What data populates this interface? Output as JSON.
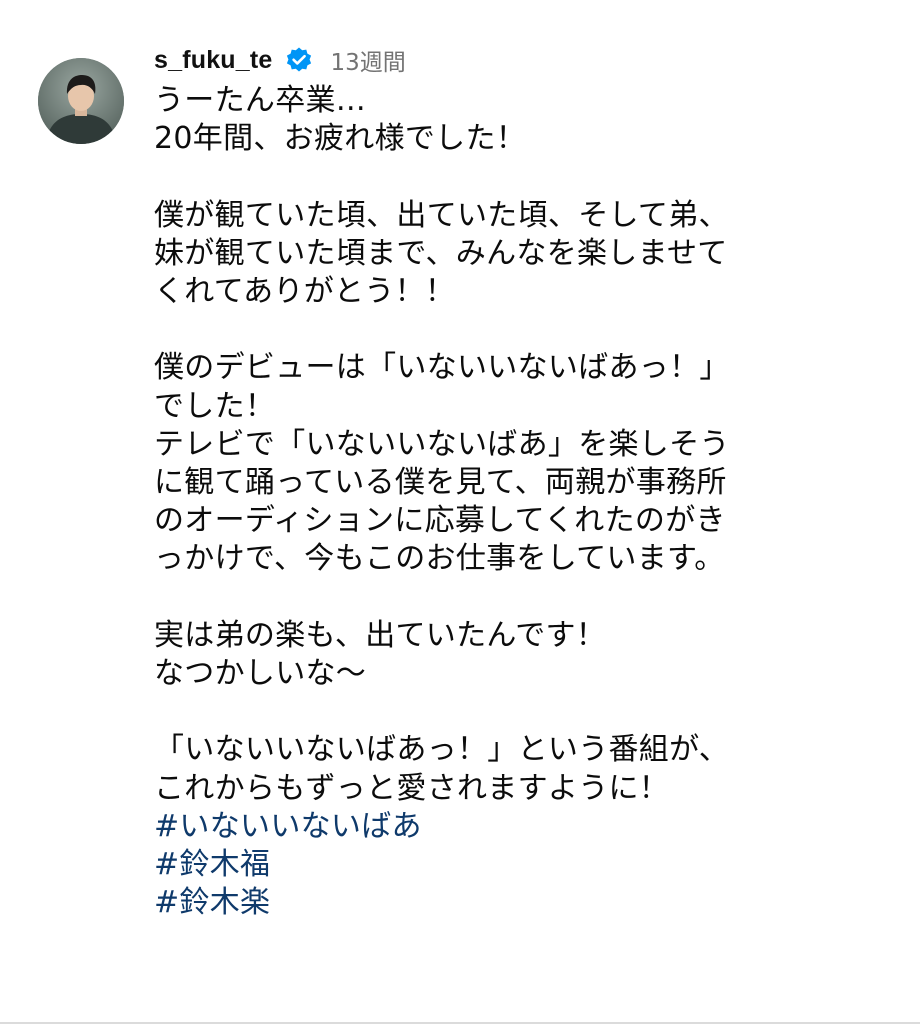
{
  "comment": {
    "username": "s_fuku_te",
    "verified_icon": "verified-badge-icon",
    "timestamp": "13週間",
    "body": "うーたん卒業…\n20年間、お疲れ様でした！\n\n僕が観ていた頃、出ていた頃、そして弟、\n妹が観ていた頃まで、みんなを楽しませて\nくれてありがとう！！\n\n僕のデビューは「いないいないばあっ！」\nでした！\nテレビで「いないいないばあ」を楽しそう\nに観て踊っている僕を見て、両親が事務所\nのオーディションに応募してくれたのがき\nっかけで、今もこのお仕事をしています。\n\n実は弟の楽も、出ていたんです！\nなつかしいな〜\n\n「いないいないばあっ！」という番組が、\nこれからもずっと愛されますように！\n",
    "hashtags": [
      "#いないいないばあ",
      "#鈴木福",
      "#鈴木楽"
    ]
  },
  "colors": {
    "hashtag": "#0f3a6b",
    "verified": "#0095f6",
    "timestamp": "#737373"
  }
}
